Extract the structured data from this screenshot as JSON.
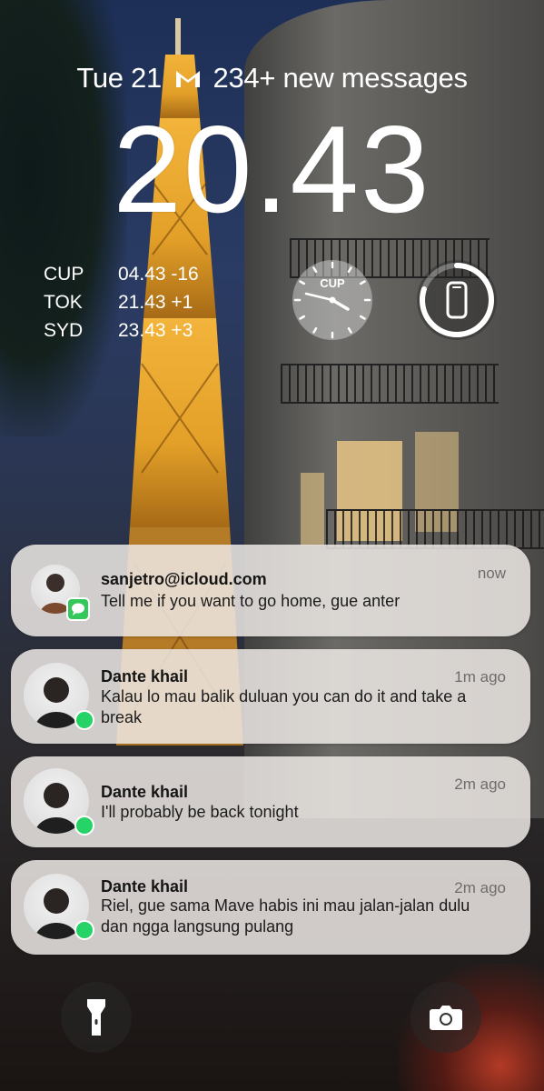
{
  "status_bar": {
    "date": "Tue 21",
    "messages": "234+ new messages",
    "mail_icon": "gmail-icon"
  },
  "clock": "20.43",
  "world_clock": [
    {
      "city": "CUP",
      "time": "04.43 -16"
    },
    {
      "city": "TOK",
      "time": "21.43 +1"
    },
    {
      "city": "SYD",
      "time": "23.43 +3"
    }
  ],
  "analog_clock": {
    "label": "CUP",
    "hour": 4,
    "minute": 43
  },
  "battery_widget": {
    "icon": "phone-icon",
    "level": 0.8
  },
  "notifications": [
    {
      "sender": "sanjetro@icloud.com",
      "time": "now",
      "message": "Tell me if you want to go home, gue anter",
      "app": "messages",
      "badge_color": "#34c759"
    },
    {
      "sender": "Dante khail",
      "time": "1m ago",
      "message": "Kalau lo mau balik duluan you can do it and take a break",
      "app": "whatsapp",
      "badge_color": "#25d366"
    },
    {
      "sender": "Dante khail",
      "time": "2m ago",
      "message": "I'll probably be back tonight",
      "app": "whatsapp",
      "badge_color": "#25d366"
    },
    {
      "sender": "Dante khail",
      "time": "2m ago",
      "message": "Riel, gue sama Mave habis ini mau jalan-jalan dulu dan ngga langsung pulang",
      "app": "whatsapp",
      "badge_color": "#25d366"
    }
  ],
  "controls": {
    "left": "flashlight-icon",
    "right": "camera-icon"
  }
}
